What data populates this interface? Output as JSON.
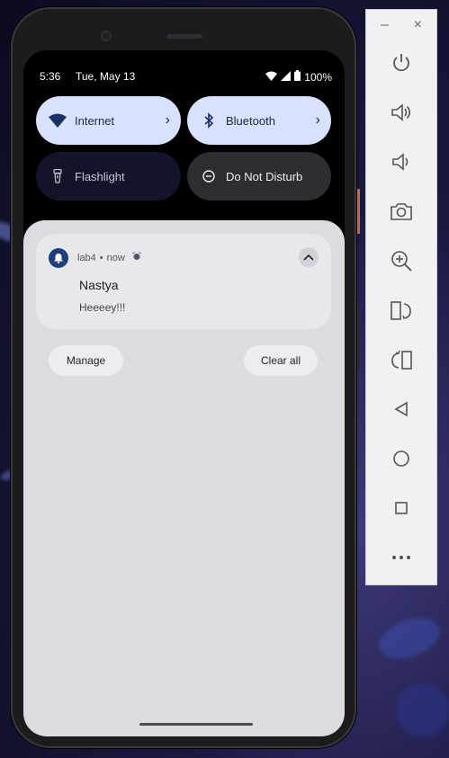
{
  "status_bar": {
    "time": "5:36",
    "date": "Tue, May 13",
    "battery": "100%"
  },
  "quick_tiles": {
    "internet": {
      "label": "Internet",
      "icon": "wifi-icon"
    },
    "bluetooth": {
      "label": "Bluetooth",
      "icon": "bluetooth-icon"
    },
    "flashlight": {
      "label": "Flashlight",
      "icon": "flashlight-icon"
    },
    "dnd": {
      "label": "Do Not Disturb",
      "icon": "dnd-icon"
    }
  },
  "notification": {
    "app_name": "lab4",
    "separator": "•",
    "time": "now",
    "title": "Nastya",
    "text": "Heeeey!!!"
  },
  "shade_actions": {
    "manage": "Manage",
    "clear_all": "Clear all"
  },
  "emulator_toolbar": {
    "minimize": "–",
    "close": "×",
    "buttons": [
      "power-icon",
      "volume-up-icon",
      "volume-down-icon",
      "camera-icon",
      "zoom-icon",
      "rotate-left-icon",
      "rotate-right-icon",
      "back-icon",
      "home-icon",
      "overview-icon",
      "more-icon"
    ]
  },
  "colors": {
    "tile_on": "#d8e2ff",
    "tile_off": "#121429",
    "shade": "#dbdbe1",
    "app_icon": "#1f3f7a"
  }
}
